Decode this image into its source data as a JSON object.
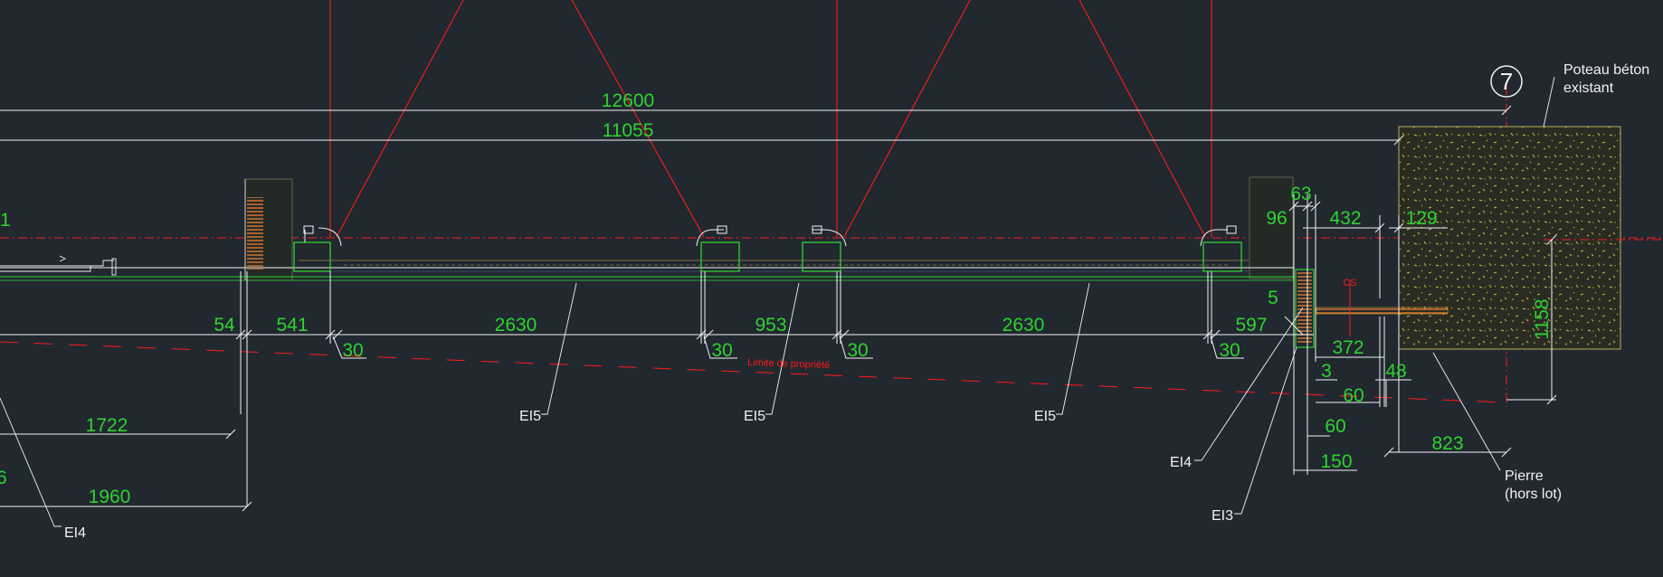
{
  "colors": {
    "background": "#212830",
    "dimension_line": "#f2f2f2",
    "dimension_text": "#2fd22f",
    "structure_red": "#ff1a1a",
    "profile_green": "#2fd22f",
    "insulation_orange": "#e07a2a",
    "concrete_fill": "#2a2c24",
    "concrete_speckle": "#c8c040"
  },
  "grid_marker": "7",
  "labels": {
    "poteau": "Poteau béton existant",
    "poteau_l1": "Poteau béton",
    "poteau_l2": "existant",
    "pierre_l1": "Pierre",
    "pierre_l2": "(hors lot)",
    "limite": "Limite de propriété",
    "cs": "CS"
  },
  "element_tags": [
    "EI5",
    "EI5",
    "EI5",
    "EI4",
    "EI3",
    "EI4"
  ],
  "dimensions": {
    "total_outer": "12600",
    "total_inner": "11055",
    "d63": "63",
    "d96": "96",
    "d432": "432",
    "d129": "129",
    "d5": "5",
    "d54": "54",
    "d541": "541",
    "d2630a": "2630",
    "d953": "953",
    "d2630b": "2630",
    "d597": "597",
    "d30a": "30",
    "d30b": "30",
    "d30c": "30",
    "d30d": "30",
    "d372": "372",
    "d3": "3",
    "d48": "48",
    "d60a": "60",
    "d60b": "60",
    "d150": "150",
    "d823": "823",
    "d1158": "1158",
    "d1722": "1722",
    "d1960": "1960",
    "edge1": "1",
    "edge6": "6"
  }
}
